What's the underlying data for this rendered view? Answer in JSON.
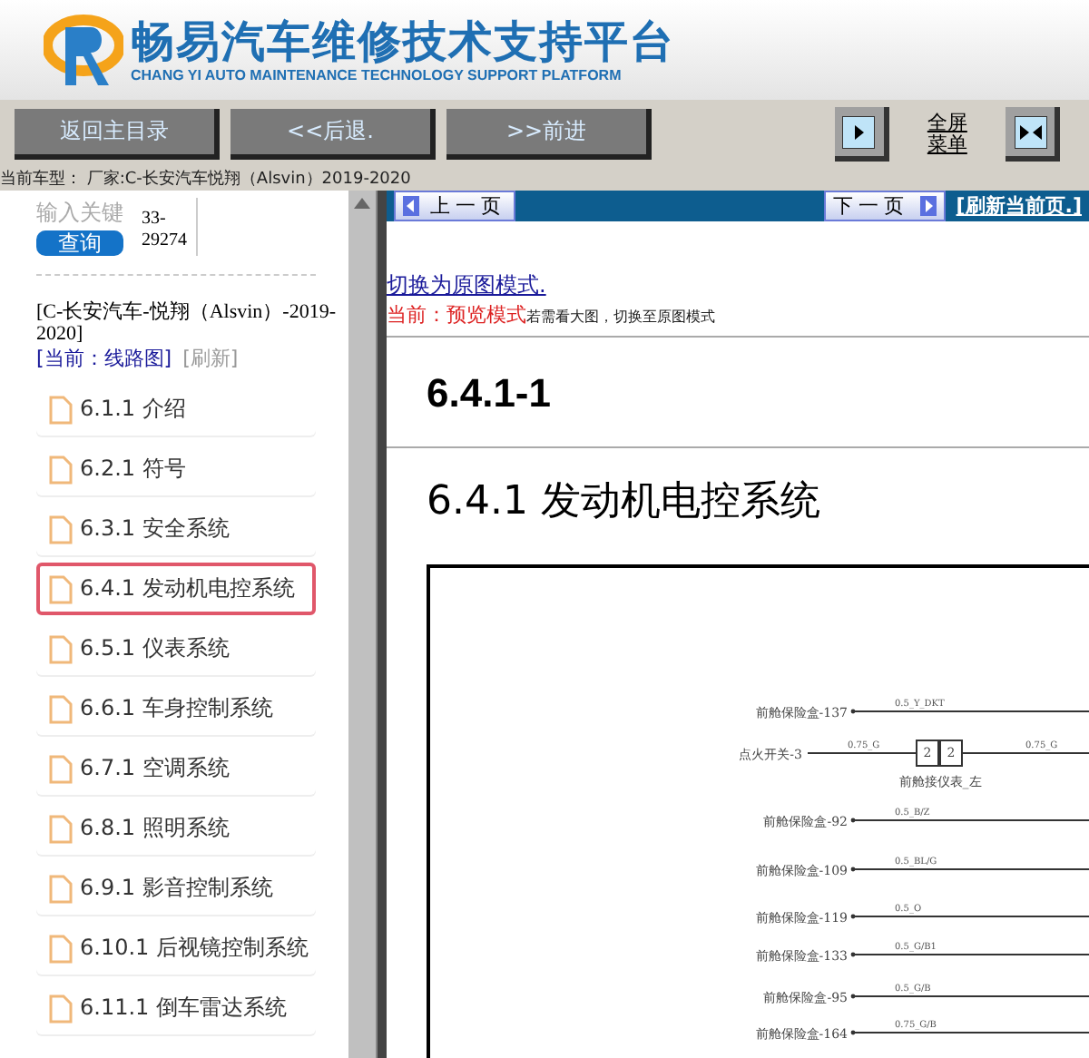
{
  "header": {
    "title": "畅易汽车维修技术支持平台",
    "subtitle": "CHANG YI AUTO MAINTENANCE TECHNOLOGY SUPPORT PLATFORM"
  },
  "toolbar": {
    "buttons": [
      "返回主目录",
      "<<后退.",
      ">>前进"
    ],
    "fullscreen_label": "全屏菜单"
  },
  "car_model": "当前车型：  厂家:C-长安汽车悦翔（Alsvin）2019-2020",
  "sidebar": {
    "search_label": "输入关键",
    "search_value": "33-29274",
    "search_button": "查询",
    "vehicle": "[C-长安汽车-悦翔（Alsvin）-2019-2020]",
    "current": "[当前：线路图]",
    "refresh": "[刷新]",
    "items": [
      {
        "label": "6.1.1 介绍",
        "selected": false
      },
      {
        "label": "6.2.1 符号",
        "selected": false
      },
      {
        "label": "6.3.1 安全系统",
        "selected": false
      },
      {
        "label": "6.4.1 发动机电控系统",
        "selected": true
      },
      {
        "label": "6.5.1 仪表系统",
        "selected": false
      },
      {
        "label": "6.6.1 车身控制系统",
        "selected": false
      },
      {
        "label": "6.7.1 空调系统",
        "selected": false
      },
      {
        "label": "6.8.1 照明系统",
        "selected": false
      },
      {
        "label": "6.9.1 影音控制系统",
        "selected": false
      },
      {
        "label": "6.10.1 后视镜控制系统",
        "selected": false
      },
      {
        "label": "6.11.1 倒车雷达系统",
        "selected": false
      }
    ]
  },
  "content": {
    "prev": "上一页",
    "next": "下一页",
    "refresh_link": "[刷新当前页.]",
    "switch_link": "切换为原图模式.",
    "mode_label": "当前：预览模式",
    "mode_hint": "若需看大图，切换至原图模式",
    "section": "6.4.1-1",
    "heading": "6.4.1 发动机电控系统",
    "diagram": [
      {
        "kind": "wire",
        "label": "前舱保险盒-137",
        "wire": "0.5_Y_DKT"
      },
      {
        "kind": "switch",
        "label": "点火开关-3",
        "wire_left": "0.75_G",
        "wire": "0.75_G",
        "pins": [
          "2",
          "2"
        ],
        "connector": "前舱接仪表_左"
      },
      {
        "kind": "wire",
        "label": "前舱保险盒-92",
        "wire": "0.5_B/Z"
      },
      {
        "kind": "wire",
        "label": "前舱保险盒-109",
        "wire": "0.5_BL/G"
      },
      {
        "kind": "wire",
        "label": "前舱保险盒-119",
        "wire": "0.5_O"
      },
      {
        "kind": "wire",
        "label": "前舱保险盒-133",
        "wire": "0.5_G/B1"
      },
      {
        "kind": "wire",
        "label": "前舱保险盒-95",
        "wire": "0.5_G/B"
      },
      {
        "kind": "wire",
        "label": "前舱保险盒-164",
        "wire": "0.75_G/B"
      }
    ]
  }
}
